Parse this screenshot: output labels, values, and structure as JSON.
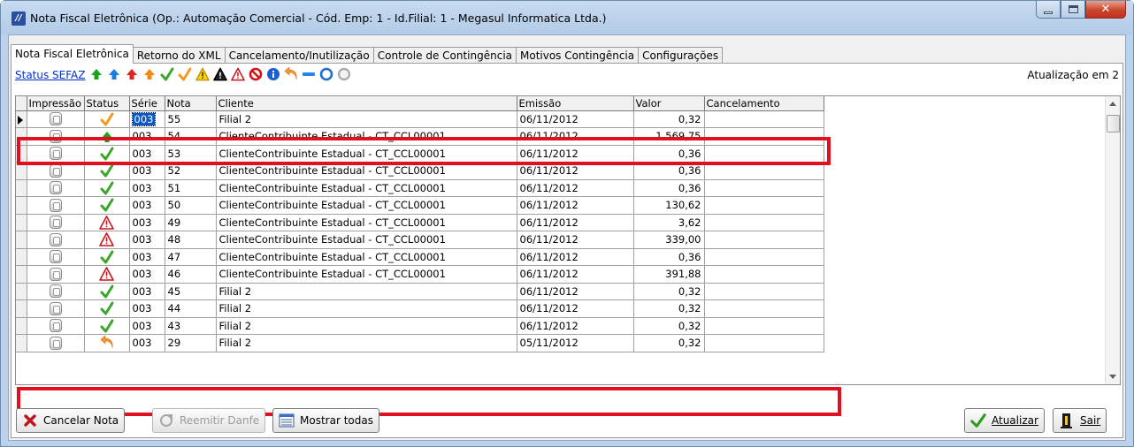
{
  "window": {
    "title": "Nota Fiscal Eletrônica (Op.: Automação Comercial - Cód. Emp: 1 - Id.Filial: 1 - Megasul Informatica Ltda.)",
    "app_icon_letter": "//"
  },
  "tabs": [
    {
      "label": "Nota Fiscal Eletrônica",
      "active": true
    },
    {
      "label": "Retorno do XML",
      "active": false
    },
    {
      "label": "Cancelamento/Inutilização",
      "active": false
    },
    {
      "label": "Controle de Contingência",
      "active": false
    },
    {
      "label": "Motivos Contingência",
      "active": false
    },
    {
      "label": "Configurações",
      "active": false
    }
  ],
  "toolbar": {
    "status_link": "Status SEFAZ",
    "update_text": "Atualização em 2",
    "legend_icons": [
      "arrow-up-green",
      "arrow-up-blue",
      "arrow-up-red",
      "arrow-up-orange",
      "check-green",
      "check-orange",
      "warning-yellow",
      "warning-black",
      "warning-red",
      "forbidden-red",
      "info-blue",
      "undo-orange",
      "minus-blue",
      "circle-blue",
      "circle-gray"
    ]
  },
  "grid": {
    "columns": [
      "Impressão",
      "Status",
      "Série",
      "Nota",
      "Cliente",
      "Emissão",
      "Valor",
      "Cancelamento"
    ],
    "rows": [
      {
        "status": "check-orange",
        "serie": "003",
        "nota": "55",
        "cliente": "Filial 2",
        "emissao": "06/11/2012",
        "valor": "0,32",
        "cancelamento": "",
        "current": true
      },
      {
        "status": "arrow-up-green",
        "serie": "003",
        "nota": "54",
        "cliente": "ClienteContribuinte Estadual - CT_CCL00001",
        "emissao": "06/11/2012",
        "valor": "1.569,75",
        "cancelamento": ""
      },
      {
        "status": "check-green",
        "serie": "003",
        "nota": "53",
        "cliente": "ClienteContribuinte Estadual - CT_CCL00001",
        "emissao": "06/11/2012",
        "valor": "0,36",
        "cancelamento": ""
      },
      {
        "status": "check-green",
        "serie": "003",
        "nota": "52",
        "cliente": "ClienteContribuinte Estadual - CT_CCL00001",
        "emissao": "06/11/2012",
        "valor": "0,36",
        "cancelamento": ""
      },
      {
        "status": "check-green",
        "serie": "003",
        "nota": "51",
        "cliente": "ClienteContribuinte Estadual - CT_CCL00001",
        "emissao": "06/11/2012",
        "valor": "0,36",
        "cancelamento": ""
      },
      {
        "status": "check-green",
        "serie": "003",
        "nota": "50",
        "cliente": "ClienteContribuinte Estadual - CT_CCL00001",
        "emissao": "06/11/2012",
        "valor": "130,62",
        "cancelamento": ""
      },
      {
        "status": "warning-red",
        "serie": "003",
        "nota": "49",
        "cliente": "ClienteContribuinte Estadual - CT_CCL00001",
        "emissao": "06/11/2012",
        "valor": "3,62",
        "cancelamento": ""
      },
      {
        "status": "warning-red",
        "serie": "003",
        "nota": "48",
        "cliente": "ClienteContribuinte Estadual - CT_CCL00001",
        "emissao": "06/11/2012",
        "valor": "339,00",
        "cancelamento": ""
      },
      {
        "status": "check-green",
        "serie": "003",
        "nota": "47",
        "cliente": "ClienteContribuinte Estadual - CT_CCL00001",
        "emissao": "06/11/2012",
        "valor": "0,36",
        "cancelamento": ""
      },
      {
        "status": "warning-red",
        "serie": "003",
        "nota": "46",
        "cliente": "ClienteContribuinte Estadual - CT_CCL00001",
        "emissao": "06/11/2012",
        "valor": "391,88",
        "cancelamento": ""
      },
      {
        "status": "check-green",
        "serie": "003",
        "nota": "45",
        "cliente": "Filial 2",
        "emissao": "06/11/2012",
        "valor": "0,32",
        "cancelamento": ""
      },
      {
        "status": "check-green",
        "serie": "003",
        "nota": "44",
        "cliente": "Filial 2",
        "emissao": "06/11/2012",
        "valor": "0,32",
        "cancelamento": ""
      },
      {
        "status": "check-green",
        "serie": "003",
        "nota": "43",
        "cliente": "Filial 2",
        "emissao": "06/11/2012",
        "valor": "0,32",
        "cancelamento": ""
      },
      {
        "status": "undo-orange",
        "serie": "003",
        "nota": "29",
        "cliente": "Filial 2",
        "emissao": "05/11/2012",
        "valor": "0,32",
        "cancelamento": ""
      }
    ]
  },
  "buttons": {
    "cancel_note": "Cancelar Nota",
    "reissue_danfe": "Reemitir Danfe",
    "show_all": "Mostrar todas",
    "refresh": "Atualizar",
    "exit": "Sair"
  },
  "colors": {
    "highlight_box": "#e01020",
    "selection": "#0a58c8",
    "link": "#0033cc"
  }
}
